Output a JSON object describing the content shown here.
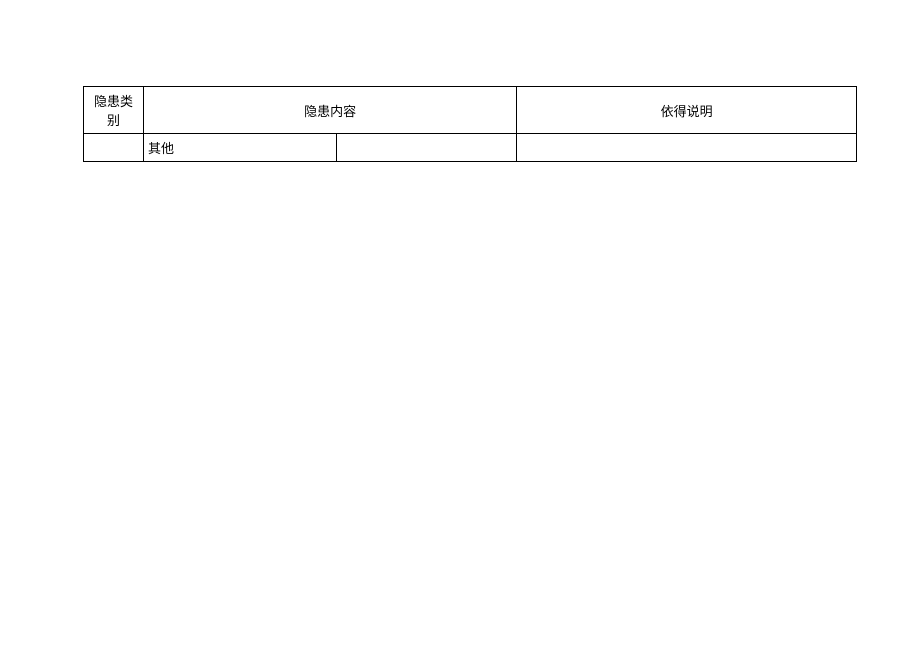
{
  "table": {
    "headers": {
      "category": "隐患类别",
      "content": "隐患内容",
      "description": "依得说明"
    },
    "rows": [
      {
        "sub": "其他",
        "content": "",
        "description": ""
      }
    ]
  }
}
